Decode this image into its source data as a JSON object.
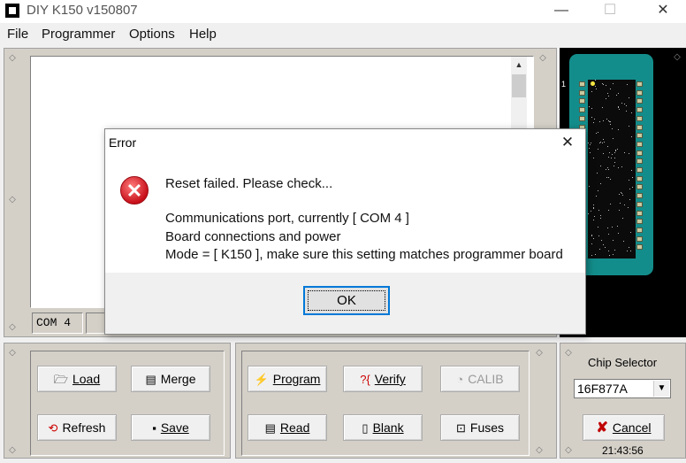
{
  "window": {
    "title": "DIY K150 v150807",
    "minimize": "—",
    "maximize": "☐",
    "close": "✕"
  },
  "menu": [
    "File",
    "Programmer",
    "Options",
    "Help"
  ],
  "status": {
    "port": "COM 4"
  },
  "file_buttons": {
    "load": "Load",
    "merge": "Merge",
    "refresh": "Refresh",
    "save": "Save"
  },
  "prog_buttons": {
    "program": "Program",
    "verify": "Verify",
    "calib": "CALIB",
    "read": "Read",
    "blank": "Blank",
    "fuses": "Fuses"
  },
  "chip_selector": {
    "label": "Chip Selector",
    "selected": "16F877A",
    "cancel": "Cancel",
    "time": "21:43:56",
    "pin1": "1"
  },
  "dialog": {
    "title": "Error",
    "close": "✕",
    "line1": "Reset failed. Please check...",
    "line2": "Communications port, currently [ COM 4 ]",
    "line3": "Board connections and power",
    "line4": "Mode =  [ K150 ], make sure this setting matches programmer board",
    "ok": "OK"
  },
  "icons": {
    "error": "error-icon",
    "load": "folder-icon",
    "merge": "merge-icon",
    "refresh": "refresh-icon",
    "save": "floppy-icon",
    "program": "program-icon",
    "verify": "verify-icon",
    "calib": "calib-icon",
    "read": "read-icon",
    "blank": "blank-icon",
    "fuses": "fuses-icon",
    "cancel": "cancel-x-icon"
  },
  "colors": {
    "accent": "#0078d7",
    "error_red": "#c8101a",
    "chip_socket": "#138d8b",
    "cancel_x": "#c00000"
  }
}
